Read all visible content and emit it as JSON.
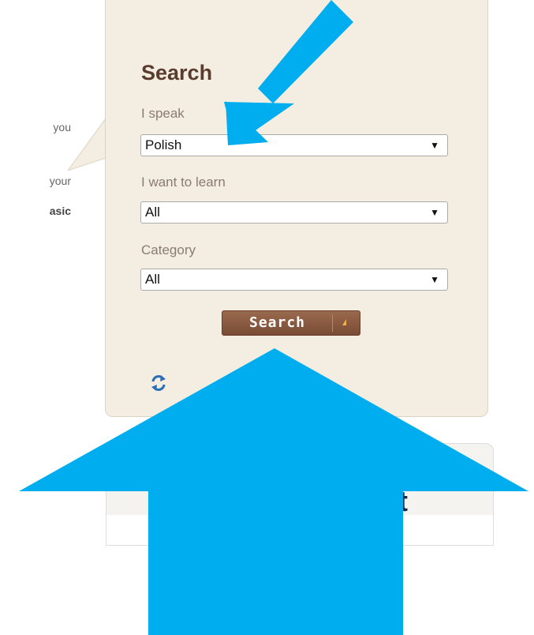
{
  "left_text": {
    "fragment_1": "you",
    "fragment_2": "your",
    "fragment_3": "asic"
  },
  "search": {
    "title": "Search",
    "speak_label": "I speak",
    "speak_value": "Polish",
    "learn_label": "I want to learn",
    "learn_value": "All",
    "category_label": "Category",
    "category_value": "All",
    "button_label": "Search",
    "dropdown_arrow": "▼"
  },
  "second_box": {
    "title_fragment": "t"
  },
  "icons": {
    "refresh": "refresh-icon",
    "annotation_small": "arrow-down-left",
    "annotation_large": "arrow-up"
  },
  "colors": {
    "panel_background": "#f4ede2",
    "title": "#5a3c2e",
    "button": "#8a5a40",
    "button_caret": "#f2b04a",
    "annotation_arrow": "#00aeef"
  }
}
